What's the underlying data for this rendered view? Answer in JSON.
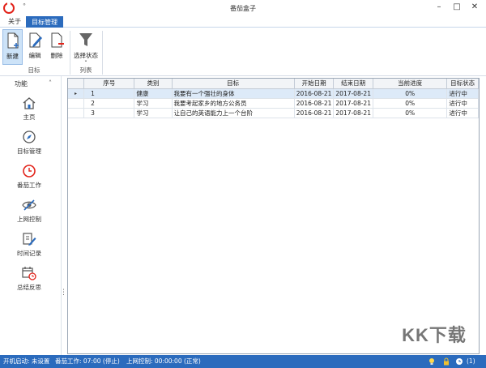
{
  "window": {
    "title": "番茄盒子",
    "quick_access": "°",
    "minimize": "–",
    "maximize": "□",
    "close": "✕"
  },
  "tabs": [
    {
      "label": "关于"
    },
    {
      "label": "目标管理"
    }
  ],
  "ribbon": {
    "buttons": [
      {
        "label": "新建",
        "icon": "new-document-icon"
      },
      {
        "label": "编辑",
        "icon": "edit-icon"
      },
      {
        "label": "删除",
        "icon": "delete-icon"
      },
      {
        "label": "选择状态",
        "icon": "filter-icon"
      }
    ],
    "groups": [
      {
        "label": "目标"
      },
      {
        "label": "列表"
      }
    ],
    "dropdown_arrow": "ˇ"
  },
  "sidebar": {
    "title": "功能",
    "collapse_glyph": "˄",
    "splitter_glyph": "⋮",
    "items": [
      {
        "label": "主页",
        "icon": "home-icon"
      },
      {
        "label": "目标管理",
        "icon": "compass-icon"
      },
      {
        "label": "番茄工作",
        "icon": "clock-icon"
      },
      {
        "label": "上网控制",
        "icon": "eye-slash-icon"
      },
      {
        "label": "时间记录",
        "icon": "pencil-note-icon"
      },
      {
        "label": "总结反思",
        "icon": "calendar-clock-icon"
      }
    ]
  },
  "grid": {
    "columns": [
      "序号",
      "类别",
      "目标",
      "开始日期",
      "结束日期",
      "当前进度",
      "目标状态"
    ],
    "row_indicator": "▸",
    "rows": [
      [
        "1",
        "健康",
        "我要有一个强壮的身体",
        "2016-08-21",
        "2017-08-21",
        "0%",
        "进行中"
      ],
      [
        "2",
        "学习",
        "我要考起家乡的地方公务员",
        "2016-08-21",
        "2017-08-21",
        "0%",
        "进行中"
      ],
      [
        "3",
        "学习",
        "让自己的英语能力上一个台阶",
        "2016-08-21",
        "2017-08-21",
        "0%",
        "进行中"
      ]
    ]
  },
  "watermark": "KK下载",
  "status": {
    "startup": "开机启动: 未设置",
    "pomodoro": "番茄工作: 07:00 (停止)",
    "net": "上网控制: 00:00:00 (正常)",
    "count": "(1)"
  },
  "colors": {
    "accent": "#2b6bbd",
    "logo": "#e2231a"
  }
}
